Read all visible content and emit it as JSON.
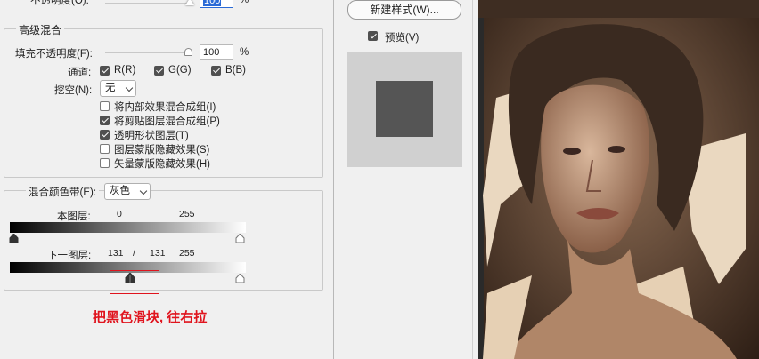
{
  "top": {
    "opacity_label": "不透明度(O):",
    "opacity_value": "100",
    "percent": "%"
  },
  "advanced": {
    "title": "高级混合",
    "fill_opacity_label": "填充不透明度(F):",
    "fill_opacity_value": "100",
    "percent": "%",
    "channels_label": "通道:",
    "channels": [
      {
        "label": "R(R)",
        "checked": true
      },
      {
        "label": "G(G)",
        "checked": true
      },
      {
        "label": "B(B)",
        "checked": true
      }
    ],
    "knockout_label": "挖空(N):",
    "knockout_value": "无",
    "options": [
      {
        "label": "将内部效果混合成组(I)",
        "checked": false
      },
      {
        "label": "将剪贴图层混合成组(P)",
        "checked": true
      },
      {
        "label": "透明形状图层(T)",
        "checked": true
      },
      {
        "label": "图层蒙版隐藏效果(S)",
        "checked": false
      },
      {
        "label": "矢量蒙版隐藏效果(H)",
        "checked": false
      }
    ]
  },
  "blend_if": {
    "label": "混合颜色带(E):",
    "value": "灰色",
    "this_layer_label": "本图层:",
    "this_layer_low": "0",
    "this_layer_high": "255",
    "underlying_label": "下一图层:",
    "underlying_low_a": "131",
    "separator": "/",
    "underlying_low_b": "131",
    "underlying_high": "255"
  },
  "right": {
    "new_style_button": "新建样式(W)...",
    "preview_label": "预览(V)",
    "preview_checked": true
  },
  "annotation": {
    "text": "把黑色滑块, 往右拉",
    "color": "#e0141e"
  }
}
